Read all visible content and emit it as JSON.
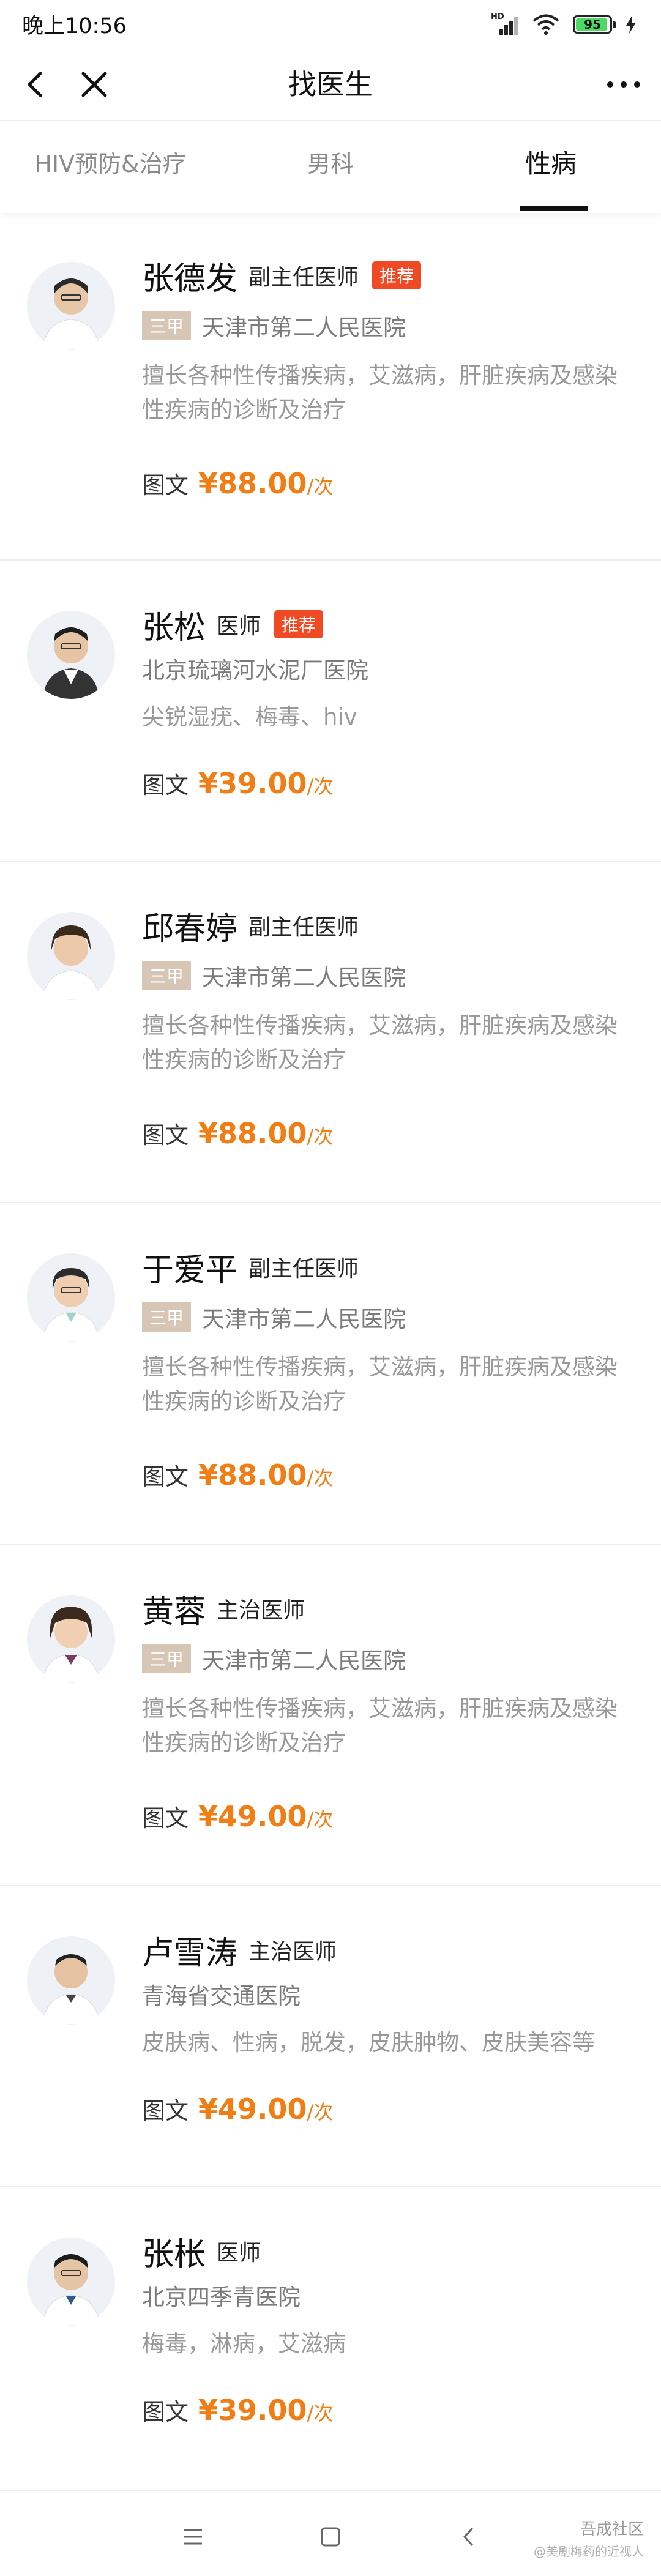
{
  "status_bar": {
    "time": "晚上10:56",
    "signal_label": "HD",
    "battery_level": "95",
    "battery_fill": 0.95,
    "icons": [
      "signal-icon",
      "wifi-icon",
      "battery-icon",
      "charging-icon"
    ]
  },
  "nav": {
    "title": "找医生",
    "icons": [
      "back-icon",
      "close-icon",
      "more-icon"
    ]
  },
  "tabs": [
    {
      "label": "HIV预防&治疗",
      "active": false
    },
    {
      "label": "男科",
      "active": false
    },
    {
      "label": "性病",
      "active": true
    }
  ],
  "doctors": [
    {
      "name": "张德发",
      "rank": "副主任医师",
      "recommended": "推荐",
      "grade": "三甲",
      "hospital": "天津市第二人民医院",
      "specialty": "擅长各种性传播疾病，艾滋病，肝脏疾病及感染性疾病的诊断及治疗",
      "consult_type": "图文",
      "price": "¥88.00",
      "unit": "/次"
    },
    {
      "name": "张松",
      "rank": "医师",
      "recommended": "推荐",
      "grade": "",
      "hospital": "北京琉璃河水泥厂医院",
      "specialty": "尖锐湿疣、梅毒、hiv",
      "consult_type": "图文",
      "price": "¥39.00",
      "unit": "/次"
    },
    {
      "name": "邱春婷",
      "rank": "副主任医师",
      "recommended": "",
      "grade": "三甲",
      "hospital": "天津市第二人民医院",
      "specialty": "擅长各种性传播疾病，艾滋病，肝脏疾病及感染性疾病的诊断及治疗",
      "consult_type": "图文",
      "price": "¥88.00",
      "unit": "/次"
    },
    {
      "name": "于爱平",
      "rank": "副主任医师",
      "recommended": "",
      "grade": "三甲",
      "hospital": "天津市第二人民医院",
      "specialty": "擅长各种性传播疾病，艾滋病，肝脏疾病及感染性疾病的诊断及治疗",
      "consult_type": "图文",
      "price": "¥88.00",
      "unit": "/次"
    },
    {
      "name": "黄蓉",
      "rank": "主治医师",
      "recommended": "",
      "grade": "三甲",
      "hospital": "天津市第二人民医院",
      "specialty": "擅长各种性传播疾病，艾滋病，肝脏疾病及感染性疾病的诊断及治疗",
      "consult_type": "图文",
      "price": "¥49.00",
      "unit": "/次"
    },
    {
      "name": "卢雪涛",
      "rank": "主治医师",
      "recommended": "",
      "grade": "",
      "hospital": "青海省交通医院",
      "specialty": "皮肤病、性病，脱发，皮肤肿物、皮肤美容等",
      "consult_type": "图文",
      "price": "¥49.00",
      "unit": "/次"
    },
    {
      "name": "张枨",
      "rank": "医师",
      "recommended": "",
      "grade": "",
      "hospital": "北京四季青医院",
      "specialty": "梅毒，淋病，艾滋病",
      "consult_type": "图文",
      "price": "¥39.00",
      "unit": "/次"
    }
  ],
  "watermark": {
    "main": "吾成社区",
    "sub": "@美剧梅药的近视人"
  },
  "colors": {
    "accent_price": "#f07e14",
    "badge_recommend": "#f04a24",
    "badge_grade": "#d7c6b5"
  }
}
